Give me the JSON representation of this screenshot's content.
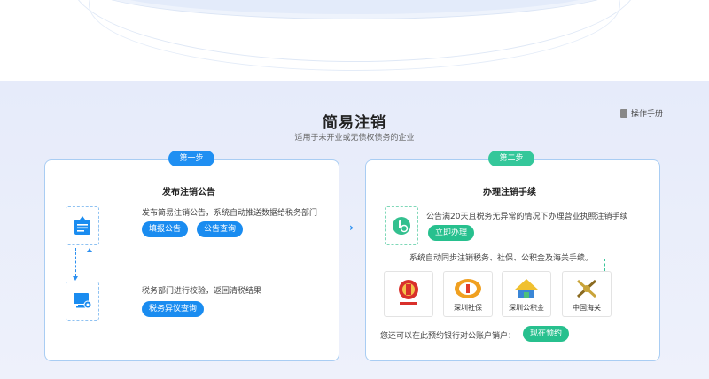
{
  "header": {
    "title": "简易注销",
    "subtitle": "适用于未开业或无债权债务的企业",
    "manual_label": "操作手册"
  },
  "step1": {
    "badge": "第一步",
    "title": "发布注销公告",
    "desc1": "发布简易注销公告，系统自动推送数据给税务部门",
    "btn_file": "填报公告",
    "btn_query": "公告查询",
    "desc2": "税务部门进行校验，返回清税结果",
    "btn_objection": "税务异议查询"
  },
  "step2": {
    "badge": "第二步",
    "title": "办理注销手续",
    "desc1": "公告满20天且税务无异常的情况下办理营业执照注销手续",
    "btn_handle": "立即办理",
    "sync_text": "系统自动同步注销税务、社保、公积金及海关手续。",
    "agencies": [
      {
        "name": "",
        "icon": "tax-emblem-icon",
        "color": "#d9302b"
      },
      {
        "name": "深圳社保",
        "icon": "social-security-logo-icon",
        "color": "#f0a020"
      },
      {
        "name": "深圳公积金",
        "icon": "housing-fund-logo-icon",
        "color": "#3a86d6"
      },
      {
        "name": "中国海关",
        "icon": "customs-emblem-icon",
        "color": "#c9a43a"
      }
    ],
    "bank_text": "您还可以在此预约银行对公账户销户：",
    "btn_book": "现在预约"
  }
}
